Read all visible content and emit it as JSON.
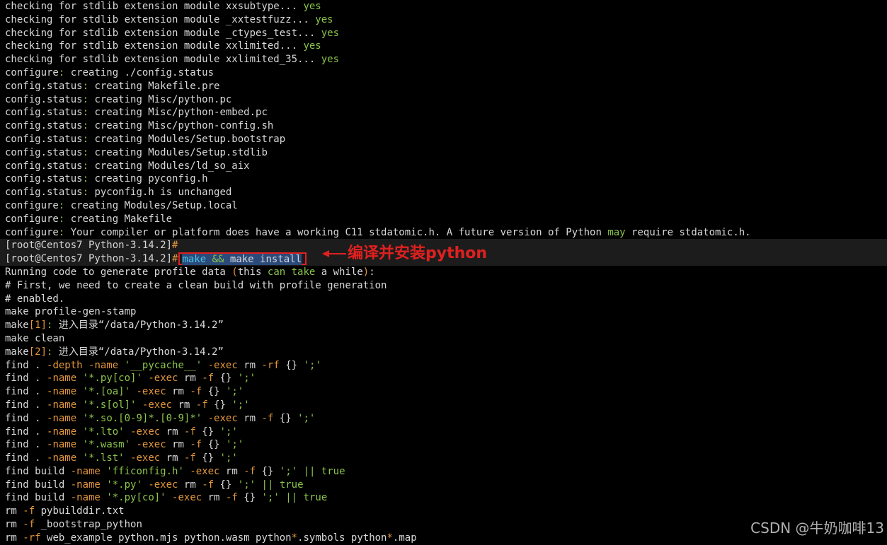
{
  "terminal": {
    "lines": [
      {
        "id": "l1",
        "segs": [
          {
            "t": "checking for stdlib extension module xxsubtype... "
          },
          {
            "t": "yes",
            "c": "g"
          }
        ]
      },
      {
        "id": "l2",
        "segs": [
          {
            "t": "checking for stdlib extension module _xxtestfuzz... "
          },
          {
            "t": "yes",
            "c": "g"
          }
        ]
      },
      {
        "id": "l3",
        "segs": [
          {
            "t": "checking for stdlib extension module _ctypes_test... "
          },
          {
            "t": "yes",
            "c": "g"
          }
        ]
      },
      {
        "id": "l4",
        "segs": [
          {
            "t": "checking for stdlib extension module xxlimited... "
          },
          {
            "t": "yes",
            "c": "g"
          }
        ]
      },
      {
        "id": "l5",
        "segs": [
          {
            "t": "checking for stdlib extension module xxlimited_35... "
          },
          {
            "t": "yes",
            "c": "g"
          }
        ]
      },
      {
        "id": "l6",
        "segs": [
          {
            "t": "configure"
          },
          {
            "t": ":",
            "c": "g"
          },
          {
            "t": " creating ./config.status"
          }
        ]
      },
      {
        "id": "l7",
        "segs": [
          {
            "t": "config.status"
          },
          {
            "t": ":",
            "c": "g"
          },
          {
            "t": " creating Makefile.pre"
          }
        ]
      },
      {
        "id": "l8",
        "segs": [
          {
            "t": "config.status"
          },
          {
            "t": ":",
            "c": "g"
          },
          {
            "t": " creating Misc/python.pc"
          }
        ]
      },
      {
        "id": "l9",
        "segs": [
          {
            "t": "config.status"
          },
          {
            "t": ":",
            "c": "g"
          },
          {
            "t": " creating Misc/python-embed.pc"
          }
        ]
      },
      {
        "id": "l10",
        "segs": [
          {
            "t": "config.status"
          },
          {
            "t": ":",
            "c": "g"
          },
          {
            "t": " creating Misc/python-config.sh"
          }
        ]
      },
      {
        "id": "l11",
        "segs": [
          {
            "t": "config.status"
          },
          {
            "t": ":",
            "c": "g"
          },
          {
            "t": " creating Modules/Setup.bootstrap"
          }
        ]
      },
      {
        "id": "l12",
        "segs": [
          {
            "t": "config.status"
          },
          {
            "t": ":",
            "c": "g"
          },
          {
            "t": " creating Modules/Setup.stdlib"
          }
        ]
      },
      {
        "id": "l13",
        "segs": [
          {
            "t": "config.status"
          },
          {
            "t": ":",
            "c": "g"
          },
          {
            "t": " creating Modules/ld_so_aix"
          }
        ]
      },
      {
        "id": "l14",
        "segs": [
          {
            "t": "config.status"
          },
          {
            "t": ":",
            "c": "g"
          },
          {
            "t": " creating pyconfig.h"
          }
        ]
      },
      {
        "id": "l15",
        "segs": [
          {
            "t": "config.status"
          },
          {
            "t": ":",
            "c": "g"
          },
          {
            "t": " pyconfig.h is unchanged"
          }
        ]
      },
      {
        "id": "l16",
        "segs": [
          {
            "t": "configure"
          },
          {
            "t": ":",
            "c": "g"
          },
          {
            "t": " creating Modules/Setup.local"
          }
        ]
      },
      {
        "id": "l17",
        "segs": [
          {
            "t": "configure"
          },
          {
            "t": ":",
            "c": "g"
          },
          {
            "t": " creating Makefile"
          }
        ]
      },
      {
        "id": "l18",
        "segs": [
          {
            "t": "configure"
          },
          {
            "t": ":",
            "c": "g"
          },
          {
            "t": " Your compiler or platform does have a working C11 stdatomic.h. A future version of Python "
          },
          {
            "t": "may",
            "c": "g"
          },
          {
            "t": " require stdatomic.h."
          }
        ]
      },
      {
        "id": "l19",
        "highlight": true,
        "segs": [
          {
            "t": "[root@Centos7 Python-3.14.2]"
          },
          {
            "t": "#",
            "c": "o"
          }
        ]
      },
      {
        "id": "l20",
        "highlight": true,
        "command": true,
        "segs": [
          {
            "t": "[root@Centos7 Python-3.14.2]"
          },
          {
            "t": "#",
            "c": "o"
          }
        ],
        "cmd": [
          {
            "t": "make",
            "c": "c"
          },
          {
            "t": " "
          },
          {
            "t": "&&",
            "c": "g"
          },
          {
            "t": " make install"
          }
        ]
      },
      {
        "id": "l21",
        "segs": [
          {
            "t": "Running code to generate profile data "
          },
          {
            "t": "(",
            "c": "o"
          },
          {
            "t": "this "
          },
          {
            "t": "can take",
            "c": "g"
          },
          {
            "t": " a while"
          },
          {
            "t": ")",
            "c": "o"
          },
          {
            "t": ":"
          }
        ]
      },
      {
        "id": "l22",
        "segs": [
          {
            "t": "# First, we need to create a clean build with profile generation"
          }
        ]
      },
      {
        "id": "l23",
        "segs": [
          {
            "t": "# enabled."
          }
        ]
      },
      {
        "id": "l24",
        "segs": [
          {
            "t": "make profile-gen-stamp"
          }
        ]
      },
      {
        "id": "l25",
        "segs": [
          {
            "t": "make"
          },
          {
            "t": "[1]",
            "c": "o"
          },
          {
            "t": ":",
            "c": "g"
          },
          {
            "t": " 进入目录“/data/Python-3.14.2”"
          }
        ]
      },
      {
        "id": "l26",
        "segs": [
          {
            "t": "make clean"
          }
        ]
      },
      {
        "id": "l27",
        "segs": [
          {
            "t": "make"
          },
          {
            "t": "[2]",
            "c": "o"
          },
          {
            "t": ":",
            "c": "g"
          },
          {
            "t": " 进入目录“/data/Python-3.14.2”"
          }
        ]
      },
      {
        "id": "l28",
        "segs": [
          {
            "t": "find . "
          },
          {
            "t": "-depth -name",
            "c": "o"
          },
          {
            "t": " "
          },
          {
            "t": "'__pycache__'",
            "c": "g"
          },
          {
            "t": " "
          },
          {
            "t": "-exec",
            "c": "o"
          },
          {
            "t": " rm "
          },
          {
            "t": "-rf",
            "c": "o"
          },
          {
            "t": " {} "
          },
          {
            "t": "';'",
            "c": "g"
          }
        ]
      },
      {
        "id": "l29",
        "segs": [
          {
            "t": "find . "
          },
          {
            "t": "-name",
            "c": "o"
          },
          {
            "t": " "
          },
          {
            "t": "'*.py[co]'",
            "c": "g"
          },
          {
            "t": " "
          },
          {
            "t": "-exec",
            "c": "o"
          },
          {
            "t": " rm "
          },
          {
            "t": "-f",
            "c": "o"
          },
          {
            "t": " {} "
          },
          {
            "t": "';'",
            "c": "g"
          }
        ]
      },
      {
        "id": "l30",
        "segs": [
          {
            "t": "find . "
          },
          {
            "t": "-name",
            "c": "o"
          },
          {
            "t": " "
          },
          {
            "t": "'*.[oa]'",
            "c": "g"
          },
          {
            "t": " "
          },
          {
            "t": "-exec",
            "c": "o"
          },
          {
            "t": " rm "
          },
          {
            "t": "-f",
            "c": "o"
          },
          {
            "t": " {} "
          },
          {
            "t": "';'",
            "c": "g"
          }
        ]
      },
      {
        "id": "l31",
        "segs": [
          {
            "t": "find . "
          },
          {
            "t": "-name",
            "c": "o"
          },
          {
            "t": " "
          },
          {
            "t": "'*.s[ol]'",
            "c": "g"
          },
          {
            "t": " "
          },
          {
            "t": "-exec",
            "c": "o"
          },
          {
            "t": " rm "
          },
          {
            "t": "-f",
            "c": "o"
          },
          {
            "t": " {} "
          },
          {
            "t": "';'",
            "c": "g"
          }
        ]
      },
      {
        "id": "l32",
        "segs": [
          {
            "t": "find . "
          },
          {
            "t": "-name",
            "c": "o"
          },
          {
            "t": " "
          },
          {
            "t": "'*.so.[0-9]*.[0-9]*'",
            "c": "g"
          },
          {
            "t": " "
          },
          {
            "t": "-exec",
            "c": "o"
          },
          {
            "t": " rm "
          },
          {
            "t": "-f",
            "c": "o"
          },
          {
            "t": " {} "
          },
          {
            "t": "';'",
            "c": "g"
          }
        ]
      },
      {
        "id": "l33",
        "segs": [
          {
            "t": "find . "
          },
          {
            "t": "-name",
            "c": "o"
          },
          {
            "t": " "
          },
          {
            "t": "'*.lto'",
            "c": "g"
          },
          {
            "t": " "
          },
          {
            "t": "-exec",
            "c": "o"
          },
          {
            "t": " rm "
          },
          {
            "t": "-f",
            "c": "o"
          },
          {
            "t": " {} "
          },
          {
            "t": "';'",
            "c": "g"
          }
        ]
      },
      {
        "id": "l34",
        "segs": [
          {
            "t": "find . "
          },
          {
            "t": "-name",
            "c": "o"
          },
          {
            "t": " "
          },
          {
            "t": "'*.wasm'",
            "c": "g"
          },
          {
            "t": " "
          },
          {
            "t": "-exec",
            "c": "o"
          },
          {
            "t": " rm "
          },
          {
            "t": "-f",
            "c": "o"
          },
          {
            "t": " {} "
          },
          {
            "t": "';'",
            "c": "g"
          }
        ]
      },
      {
        "id": "l35",
        "segs": [
          {
            "t": "find . "
          },
          {
            "t": "-name",
            "c": "o"
          },
          {
            "t": " "
          },
          {
            "t": "'*.lst'",
            "c": "g"
          },
          {
            "t": " "
          },
          {
            "t": "-exec",
            "c": "o"
          },
          {
            "t": " rm "
          },
          {
            "t": "-f",
            "c": "o"
          },
          {
            "t": " {} "
          },
          {
            "t": "';'",
            "c": "g"
          }
        ]
      },
      {
        "id": "l36",
        "segs": [
          {
            "t": "find build "
          },
          {
            "t": "-name",
            "c": "o"
          },
          {
            "t": " "
          },
          {
            "t": "'fficonfig.h'",
            "c": "g"
          },
          {
            "t": " "
          },
          {
            "t": "-exec",
            "c": "o"
          },
          {
            "t": " rm "
          },
          {
            "t": "-f",
            "c": "o"
          },
          {
            "t": " {} "
          },
          {
            "t": "';'",
            "c": "g"
          },
          {
            "t": " "
          },
          {
            "t": "||",
            "c": "g"
          },
          {
            "t": " "
          },
          {
            "t": "true",
            "c": "g"
          }
        ]
      },
      {
        "id": "l37",
        "segs": [
          {
            "t": "find build "
          },
          {
            "t": "-name",
            "c": "o"
          },
          {
            "t": " "
          },
          {
            "t": "'*.py'",
            "c": "g"
          },
          {
            "t": " "
          },
          {
            "t": "-exec",
            "c": "o"
          },
          {
            "t": " rm "
          },
          {
            "t": "-f",
            "c": "o"
          },
          {
            "t": " {} "
          },
          {
            "t": "';'",
            "c": "g"
          },
          {
            "t": " "
          },
          {
            "t": "||",
            "c": "g"
          },
          {
            "t": " "
          },
          {
            "t": "true",
            "c": "g"
          }
        ]
      },
      {
        "id": "l38",
        "segs": [
          {
            "t": "find build "
          },
          {
            "t": "-name",
            "c": "o"
          },
          {
            "t": " "
          },
          {
            "t": "'*.py[co]'",
            "c": "g"
          },
          {
            "t": " "
          },
          {
            "t": "-exec",
            "c": "o"
          },
          {
            "t": " rm "
          },
          {
            "t": "-f",
            "c": "o"
          },
          {
            "t": " {} "
          },
          {
            "t": "';'",
            "c": "g"
          },
          {
            "t": " "
          },
          {
            "t": "||",
            "c": "g"
          },
          {
            "t": " "
          },
          {
            "t": "true",
            "c": "g"
          }
        ]
      },
      {
        "id": "l39",
        "segs": [
          {
            "t": "rm "
          },
          {
            "t": "-f",
            "c": "o"
          },
          {
            "t": " pybuilddir.txt"
          }
        ]
      },
      {
        "id": "l40",
        "segs": [
          {
            "t": "rm "
          },
          {
            "t": "-f",
            "c": "o"
          },
          {
            "t": " _bootstrap_python"
          }
        ]
      },
      {
        "id": "l41",
        "segs": [
          {
            "t": "rm "
          },
          {
            "t": "-rf",
            "c": "o"
          },
          {
            "t": " web_example python.mjs python.wasm python"
          },
          {
            "t": "*",
            "c": "o"
          },
          {
            "t": ".symbols python"
          },
          {
            "t": "*",
            "c": "o"
          },
          {
            "t": ".map"
          }
        ]
      }
    ]
  },
  "annotation": {
    "text": "编译并安装python",
    "color": "#e02020",
    "icon": "arrow-left-icon"
  },
  "watermark": {
    "text": "CSDN @牛奶咖啡13"
  },
  "colors": {
    "background": "#000000",
    "text": "#d8d8d8",
    "green": "#8bc34a",
    "orange": "#e2963c",
    "cyan": "#46c7e8",
    "annotation_red": "#e02020"
  }
}
